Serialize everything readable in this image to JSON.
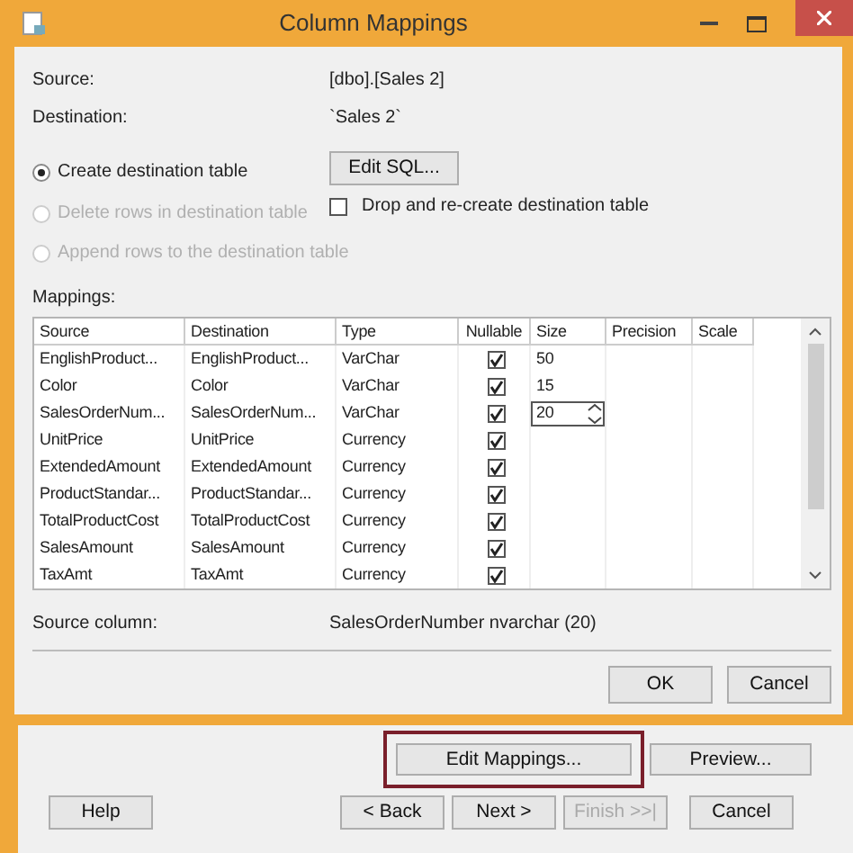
{
  "window": {
    "title": "Column Mappings"
  },
  "fields": [
    {
      "label": "Source:",
      "value": "[dbo].[Sales 2]"
    },
    {
      "label": "Destination:",
      "value": "`Sales 2`"
    }
  ],
  "options": [
    {
      "label": "Create destination table",
      "selected": true,
      "disabled": false
    },
    {
      "label": "Delete rows in destination table",
      "selected": false,
      "disabled": true
    },
    {
      "label": "Append rows to the destination table",
      "selected": false,
      "disabled": true
    }
  ],
  "edit_sql_button": "Edit SQL...",
  "drop_checkbox": {
    "label": "Drop and re-create destination table",
    "checked": false
  },
  "mappings": {
    "label": "Mappings:",
    "columns": [
      "Source",
      "Destination",
      "Type",
      "Nullable",
      "Size",
      "Precision",
      "Scale"
    ],
    "rows": [
      {
        "source": "EnglishProduct...",
        "destination": "EnglishProduct...",
        "type": "VarChar",
        "nullable": true,
        "size": "50",
        "editing": false
      },
      {
        "source": "Color",
        "destination": "Color",
        "type": "VarChar",
        "nullable": true,
        "size": "15",
        "editing": false
      },
      {
        "source": "SalesOrderNum...",
        "destination": "SalesOrderNum...",
        "type": "VarChar",
        "nullable": true,
        "size": "20",
        "editing": true
      },
      {
        "source": "UnitPrice",
        "destination": "UnitPrice",
        "type": "Currency",
        "nullable": true,
        "editing": false
      },
      {
        "source": "ExtendedAmount",
        "destination": "ExtendedAmount",
        "type": "Currency",
        "nullable": true,
        "editing": false
      },
      {
        "source": "ProductStandar...",
        "destination": "ProductStandar...",
        "type": "Currency",
        "nullable": true,
        "editing": false
      },
      {
        "source": "TotalProductCost",
        "destination": "TotalProductCost",
        "type": "Currency",
        "nullable": true,
        "editing": false
      },
      {
        "source": "SalesAmount",
        "destination": "SalesAmount",
        "type": "Currency",
        "nullable": true,
        "editing": false
      },
      {
        "source": "TaxAmt",
        "destination": "TaxAmt",
        "type": "Currency",
        "nullable": true,
        "editing": false
      }
    ]
  },
  "source_column": {
    "label": "Source column:",
    "value": "SalesOrderNumber nvarchar (20)"
  },
  "dialog_buttons": [
    "OK",
    "Cancel"
  ],
  "wizard": {
    "buttons": [
      {
        "label": "Edit Mappings...",
        "highlighted": true
      },
      {
        "label": "Preview...",
        "highlighted": false
      }
    ],
    "nav_buttons": [
      {
        "label": "Help",
        "disabled": false
      },
      {
        "label": "< Back",
        "disabled": false
      },
      {
        "label": "Next >",
        "disabled": false
      },
      {
        "label": "Finish >>|",
        "disabled": true
      },
      {
        "label": "Cancel",
        "disabled": false
      }
    ]
  }
}
